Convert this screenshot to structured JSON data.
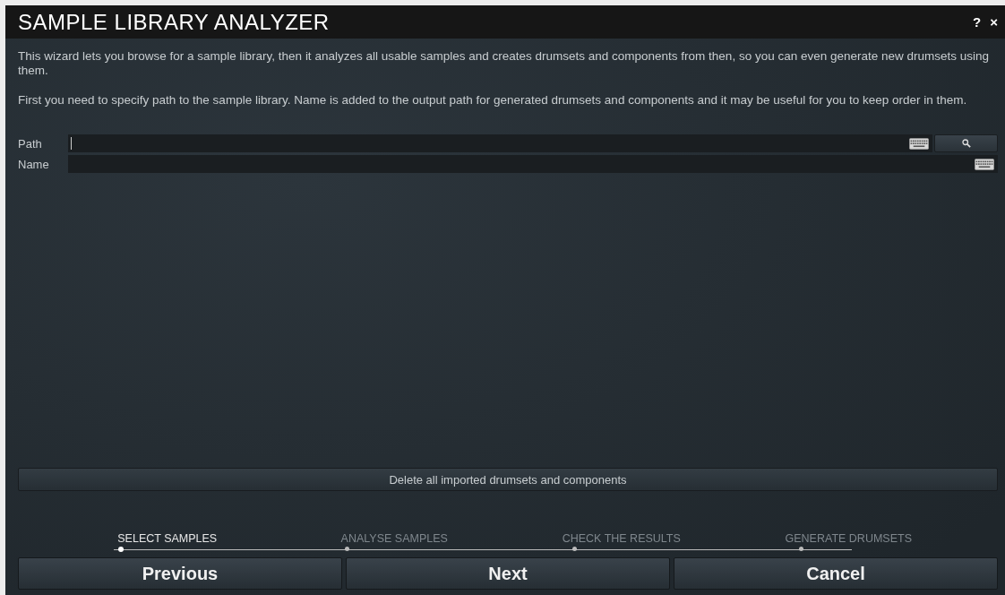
{
  "window": {
    "title": "SAMPLE LIBRARY ANALYZER",
    "help": "?",
    "close": "×"
  },
  "intro": [
    "This wizard lets you browse for a sample library, then it analyzes all usable samples and creates drumsets and components from then, so you can even generate new drumsets using them.",
    "First you need to specify path to the sample library. Name is added to the output path for generated drumsets and components and it may be useful for you to keep order in them."
  ],
  "fields": [
    {
      "label": "Path",
      "focused": true,
      "browse": true
    },
    {
      "label": "Name",
      "focused": false,
      "browse": false
    }
  ],
  "delete_button": "Delete all imported drumsets and components",
  "steps": [
    {
      "label": "SELECT SAMPLES",
      "selected": true
    },
    {
      "label": "ANALYSE SAMPLES",
      "selected": false
    },
    {
      "label": "CHECK THE RESULTS",
      "selected": false
    },
    {
      "label": "GENERATE DRUMSETS",
      "selected": false
    }
  ],
  "buttons": [
    "Previous",
    "Next",
    "Cancel"
  ]
}
